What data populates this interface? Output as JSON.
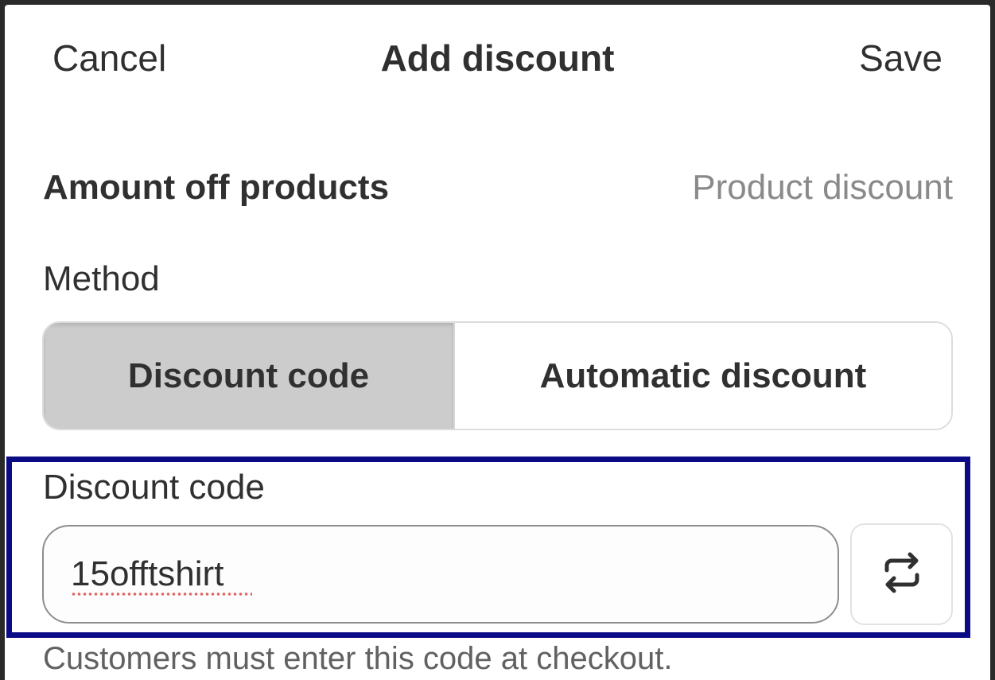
{
  "header": {
    "cancel_label": "Cancel",
    "title": "Add discount",
    "save_label": "Save"
  },
  "section": {
    "title": "Amount off products",
    "type": "Product discount"
  },
  "method": {
    "label": "Method",
    "options": [
      "Discount code",
      "Automatic discount"
    ],
    "selected": "Discount code"
  },
  "discount_code": {
    "label": "Discount code",
    "value": "15offtshirt",
    "regenerate_icon": "arrows-repeat-icon",
    "help_text": "Customers must enter this code at checkout."
  },
  "colors": {
    "highlight_border": "#0b0c85",
    "selected_segment": "#cccccc",
    "secondary_text": "#8a8a8a"
  }
}
